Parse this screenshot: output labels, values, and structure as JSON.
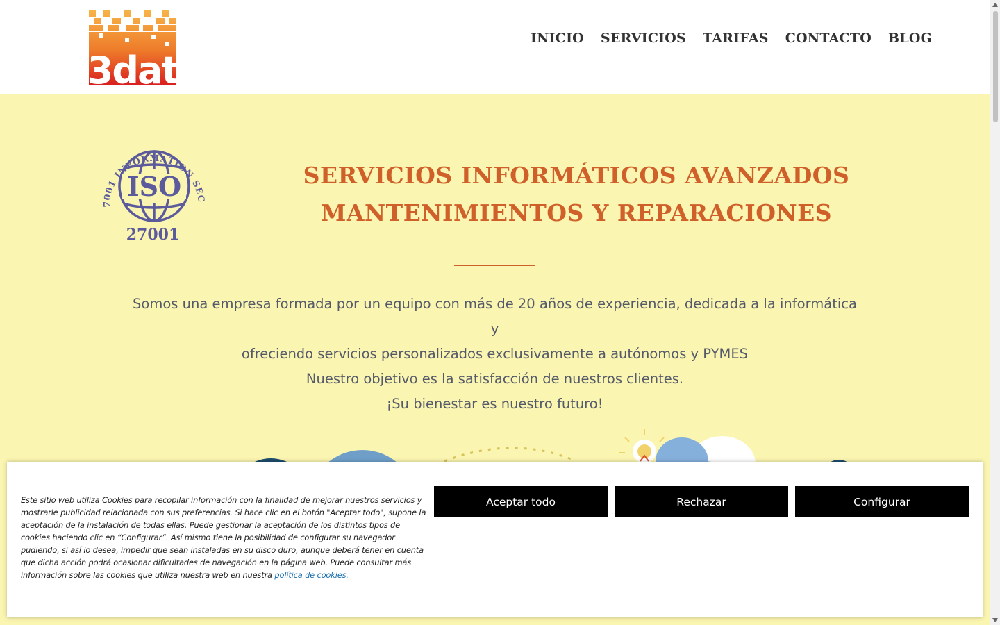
{
  "brand": {
    "logo_text": "3dat"
  },
  "nav": {
    "items": [
      {
        "label": "INICIO"
      },
      {
        "label": "SERVICIOS"
      },
      {
        "label": "TARIFAS"
      },
      {
        "label": "CONTACTO"
      },
      {
        "label": "BLOG"
      }
    ]
  },
  "iso_badge": {
    "arc_text": "ISO 27001 INFORMATION SECURITY",
    "center_text": "ISO",
    "number": "27001"
  },
  "hero": {
    "headline_line1": "SERVICIOS INFORMÁTICOS AVANZADOS",
    "headline_line2": "MANTENIMIENTOS Y REPARACIONES",
    "paragraph_line1": "Somos una empresa formada por un equipo con más de 20 años de experiencia, dedicada a la informática y",
    "paragraph_line2": "ofreciendo servicios personalizados exclusivamente a autónomos y PYMES",
    "paragraph_line3": "Nuestro objetivo es la satisfacción de nuestros clientes.",
    "paragraph_line4": "¡Su bienestar es nuestro futuro!"
  },
  "cookie_banner": {
    "text": "Este sitio web utiliza Cookies para recopilar información con la finalidad de mejorar nuestros servicios y mostrarle publicidad relacionada con sus preferencias. Si hace clic en el botón \"Aceptar todo\", supone la aceptación de la instalación de todas ellas. Puede gestionar la aceptación de los distintos tipos de cookies haciendo clic en “Configurar”. Así mismo tiene la posibilidad de configurar su navegador pudiendo, si así lo desea, impedir que sean instaladas en su disco duro, aunque deberá tener en cuenta que dicha acción podrá ocasionar dificultades de navegación en la página web. Puede consultar más información sobre las cookies que utiliza nuestra web en nuestra",
    "link_text": "política de cookies.",
    "accept_label": "Aceptar todo",
    "reject_label": "Rechazar",
    "config_label": "Configurar"
  },
  "colors": {
    "hero_background": "#faf5b0",
    "headline": "#d0602a",
    "body_text": "#555a6a",
    "iso_badge": "#5a5a9c",
    "button_background": "#000000",
    "link": "#1a6fb0"
  }
}
